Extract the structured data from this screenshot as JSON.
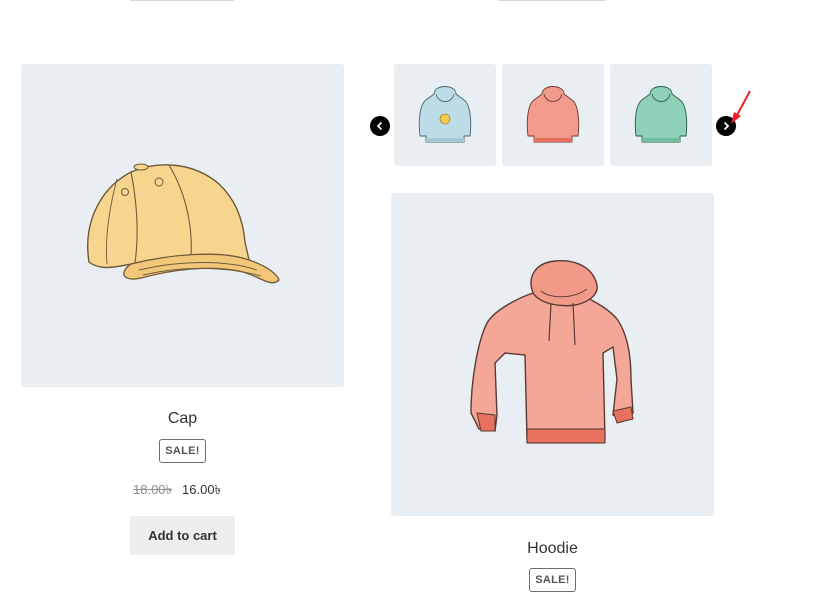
{
  "products": [
    {
      "title": "Cap",
      "sale_badge": "SALE!",
      "regular_price": "18.00৳",
      "sale_price": "16.00৳",
      "button_label": "Add to cart"
    },
    {
      "title": "Hoodie",
      "sale_badge": "SALE!"
    }
  ],
  "gallery": {
    "thumbnails": [
      {
        "name": "hoodie-blue-with-logo",
        "color": "#bcdce8"
      },
      {
        "name": "hoodie-red",
        "color": "#f29b8c"
      },
      {
        "name": "hoodie-green",
        "color": "#8fd0b8"
      }
    ],
    "prev_icon": "chevron-left-icon",
    "next_icon": "chevron-right-icon"
  },
  "colors": {
    "image_bg": "#e9eef2",
    "accent_arrow": "#e8232a",
    "button_bg": "#eeeeee"
  }
}
